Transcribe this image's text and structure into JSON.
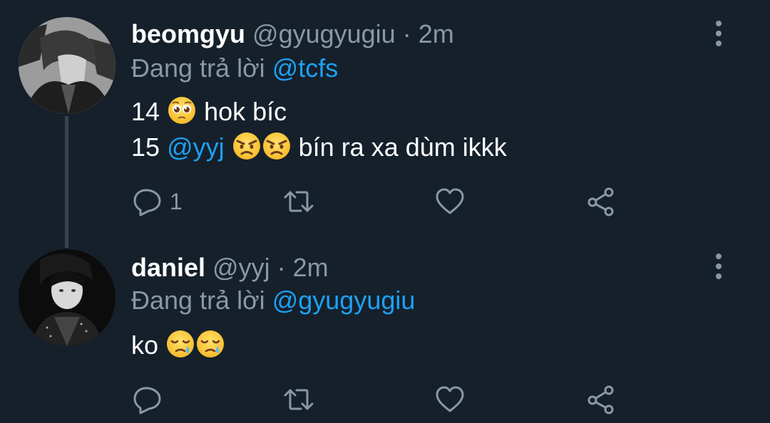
{
  "colors": {
    "background": "#15202b",
    "primary_text": "#ffffff",
    "secondary_text": "#8899a6",
    "accent": "#1da1f2",
    "thread_line": "#38444d"
  },
  "tweets": [
    {
      "name": "beomgyu",
      "handle": "@gyugyugiu",
      "separator": "·",
      "time": "2m",
      "replying_prefix": "Đang trả lời",
      "replying_to": "@tcfs",
      "lines": [
        {
          "prefix": "14",
          "emojis": [
            "pleading-face"
          ],
          "suffix": "hok bíc"
        },
        {
          "prefix": "15",
          "mention": "@yyj",
          "emojis": [
            "angry-face",
            "angry-face"
          ],
          "suffix": "bín ra xa dùm ikkk"
        }
      ],
      "actions": {
        "reply_count": "1",
        "retweet_count": "",
        "like_count": ""
      },
      "icons": [
        "more-vertical-icon",
        "reply-icon",
        "retweet-icon",
        "like-icon",
        "share-icon"
      ]
    },
    {
      "name": "daniel",
      "handle": "@yyj",
      "separator": "·",
      "time": "2m",
      "replying_prefix": "Đang trả lời",
      "replying_to": "@gyugyugiu",
      "lines": [
        {
          "prefix": "ko",
          "emojis": [
            "sad-relieved-face",
            "sad-relieved-face"
          ],
          "suffix": ""
        }
      ],
      "actions": {
        "reply_count": "",
        "retweet_count": "",
        "like_count": ""
      },
      "icons": [
        "more-vertical-icon",
        "reply-icon",
        "retweet-icon",
        "like-icon",
        "share-icon"
      ]
    }
  ]
}
